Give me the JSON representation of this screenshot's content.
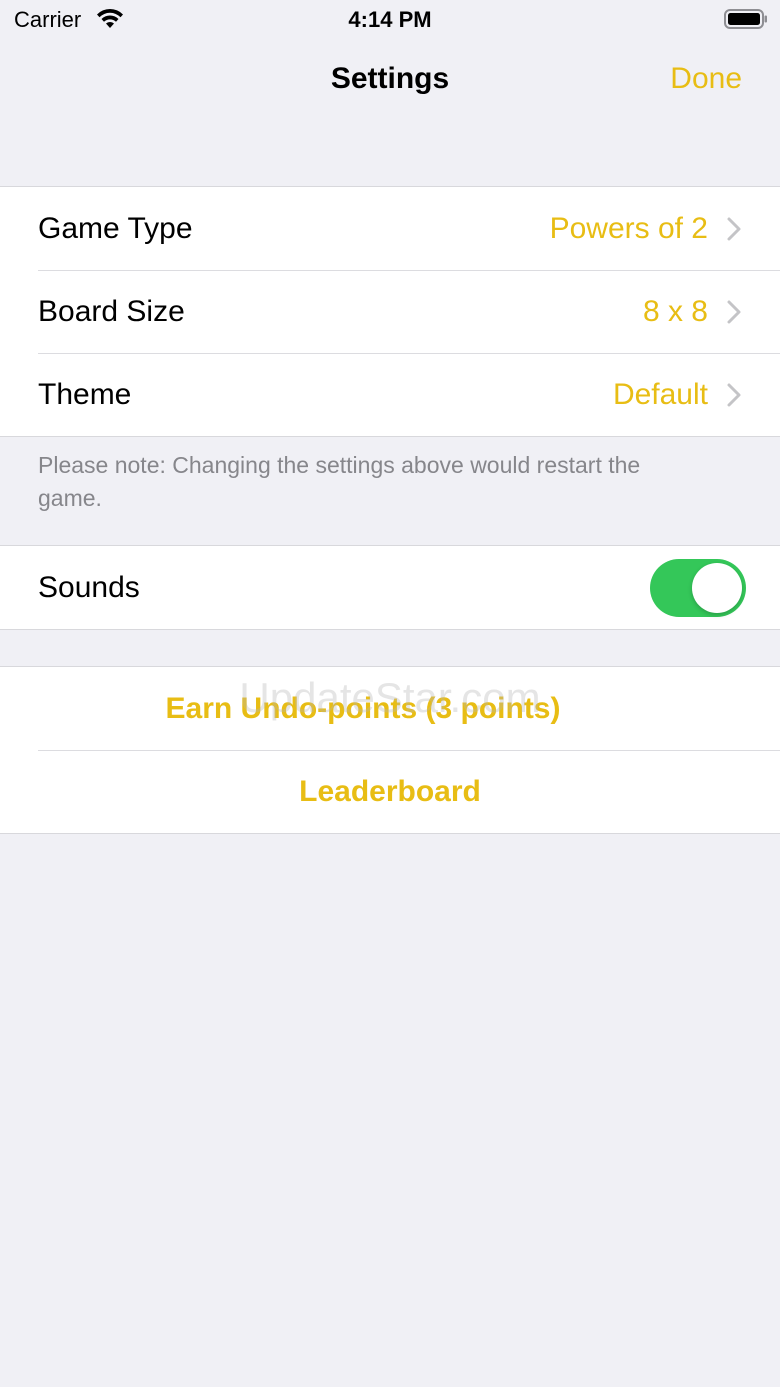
{
  "status_bar": {
    "carrier": "Carrier",
    "time": "4:14 PM",
    "wifi_icon": "wifi-icon",
    "battery_icon": "battery-icon"
  },
  "nav": {
    "title": "Settings",
    "done_label": "Done"
  },
  "game_settings": [
    {
      "label": "Game Type",
      "value": "Powers of 2"
    },
    {
      "label": "Board Size",
      "value": "8 x 8"
    },
    {
      "label": "Theme",
      "value": "Default"
    }
  ],
  "note": "Please note: Changing the settings above would restart the game.",
  "sounds": {
    "label": "Sounds",
    "enabled": true
  },
  "actions": {
    "earn_undo": "Earn Undo-points (3 points)",
    "leaderboard": "Leaderboard"
  },
  "watermark": "UpdateStar.com",
  "colors": {
    "accent": "#e8bd14",
    "toggle_on": "#34c759",
    "background": "#f0f0f5"
  }
}
